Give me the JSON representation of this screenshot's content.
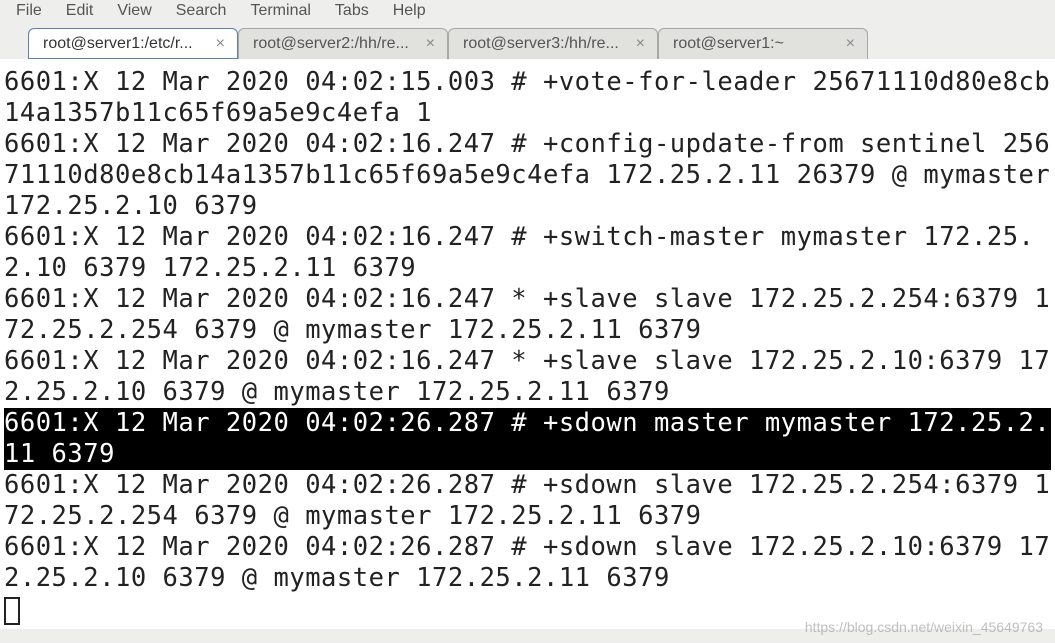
{
  "menu": {
    "file": "File",
    "edit": "Edit",
    "view": "View",
    "search": "Search",
    "terminal": "Terminal",
    "tabs": "Tabs",
    "help": "Help"
  },
  "tabs": [
    {
      "label": "root@server1:/etc/r...",
      "active": true
    },
    {
      "label": "root@server2:/hh/re...",
      "active": false
    },
    {
      "label": "root@server3:/hh/re...",
      "active": false
    },
    {
      "label": "root@server1:~",
      "active": false
    }
  ],
  "tab_close_glyph": "×",
  "log_lines": [
    {
      "text": "6601:X 12 Mar 2020 04:02:15.003 # +vote-for-leader 25671110d80e8cb14a1357b11c65f69a5e9c4efa 1",
      "highlighted": false
    },
    {
      "text": "6601:X 12 Mar 2020 04:02:16.247 # +config-update-from sentinel 25671110d80e8cb14a1357b11c65f69a5e9c4efa 172.25.2.11 26379 @ mymaster 172.25.2.10 6379",
      "highlighted": false
    },
    {
      "text": "6601:X 12 Mar 2020 04:02:16.247 # +switch-master mymaster 172.25.2.10 6379 172.25.2.11 6379",
      "highlighted": false
    },
    {
      "text": "6601:X 12 Mar 2020 04:02:16.247 * +slave slave 172.25.2.254:6379 172.25.2.254 6379 @ mymaster 172.25.2.11 6379",
      "highlighted": false
    },
    {
      "text": "6601:X 12 Mar 2020 04:02:16.247 * +slave slave 172.25.2.10:6379 172.25.2.10 6379 @ mymaster 172.25.2.11 6379",
      "highlighted": false
    },
    {
      "text": "6601:X 12 Mar 2020 04:02:26.287 # +sdown master mymaster 172.25.2.11 6379",
      "highlighted": true
    },
    {
      "text": "6601:X 12 Mar 2020 04:02:26.287 # +sdown slave 172.25.2.254:6379 172.25.2.254 6379 @ mymaster 172.25.2.11 6379",
      "highlighted": false
    },
    {
      "text": "6601:X 12 Mar 2020 04:02:26.287 # +sdown slave 172.25.2.10:6379 172.25.2.10 6379 @ mymaster 172.25.2.11 6379",
      "highlighted": false
    }
  ],
  "watermark": "https://blog.csdn.net/weixin_45649763"
}
